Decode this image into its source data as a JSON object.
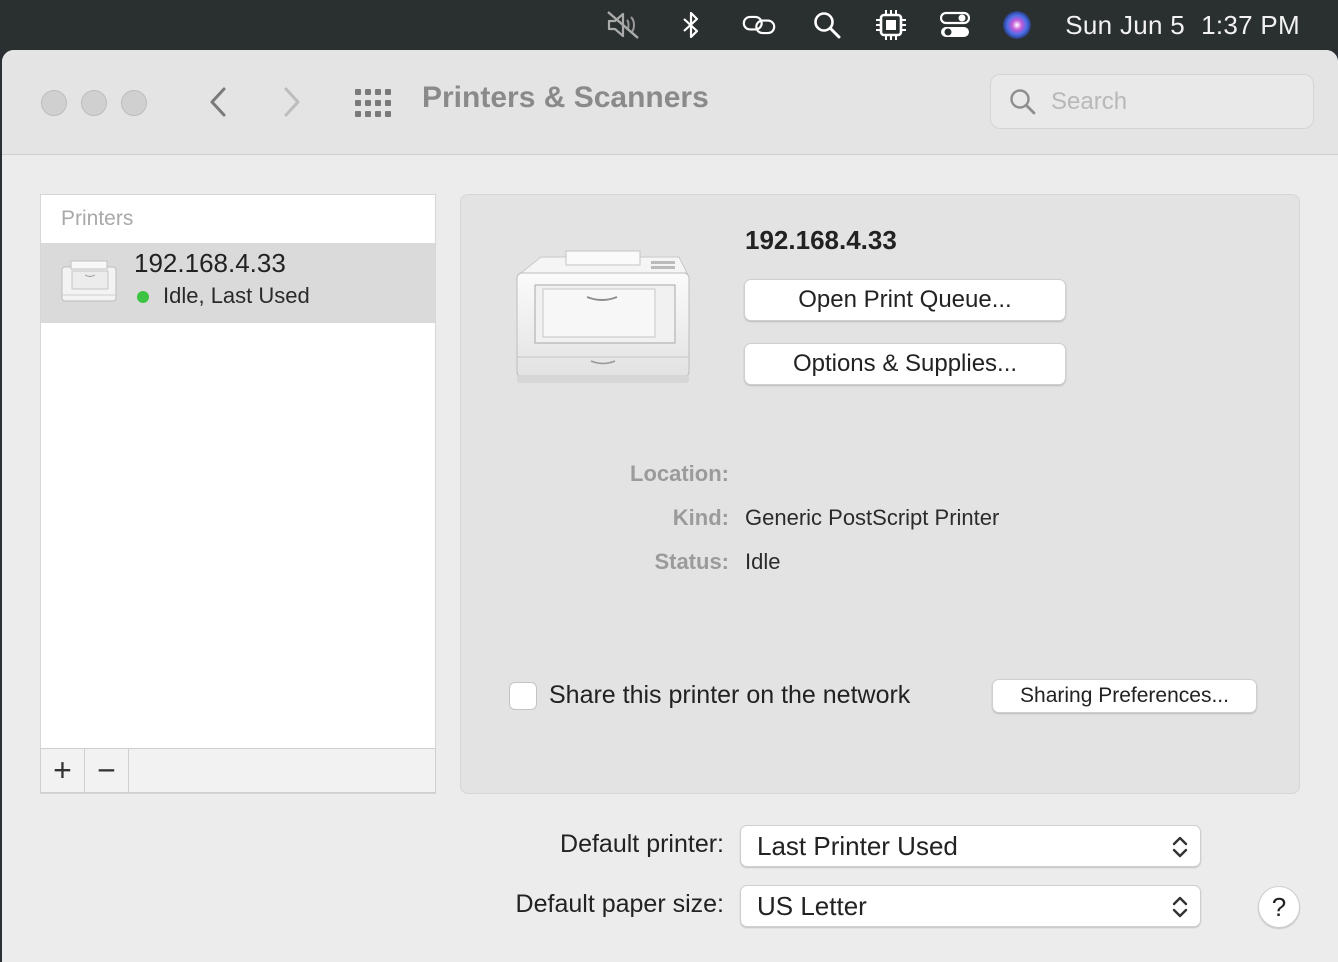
{
  "menubar": {
    "icons": [
      "muted-speaker-icon",
      "bluetooth-icon",
      "link-icon",
      "search-icon",
      "cpu-icon",
      "control-center-icon",
      "siri-icon"
    ],
    "date": "Sun Jun 5",
    "time": "1:37 PM"
  },
  "window": {
    "title": "Printers & Scanners",
    "search_placeholder": "Search"
  },
  "printer_list": {
    "header": "Printers",
    "items": [
      {
        "name": "192.168.4.33",
        "status": "Idle, Last Used",
        "status_color": "#3cc341"
      }
    ],
    "add_label": "+",
    "remove_label": "−"
  },
  "details": {
    "printer_name": "192.168.4.33",
    "open_queue_label": "Open Print Queue...",
    "options_label": "Options & Supplies...",
    "location_label": "Location:",
    "location_value": "",
    "kind_label": "Kind:",
    "kind_value": "Generic PostScript Printer",
    "status_label": "Status:",
    "status_value": "Idle",
    "share_label": "Share this printer on the network",
    "share_checked": false,
    "sharing_prefs_label": "Sharing Preferences..."
  },
  "defaults": {
    "default_printer_label": "Default printer:",
    "default_printer_value": "Last Printer Used",
    "paper_size_label": "Default paper size:",
    "paper_size_value": "US Letter",
    "help_label": "?"
  }
}
